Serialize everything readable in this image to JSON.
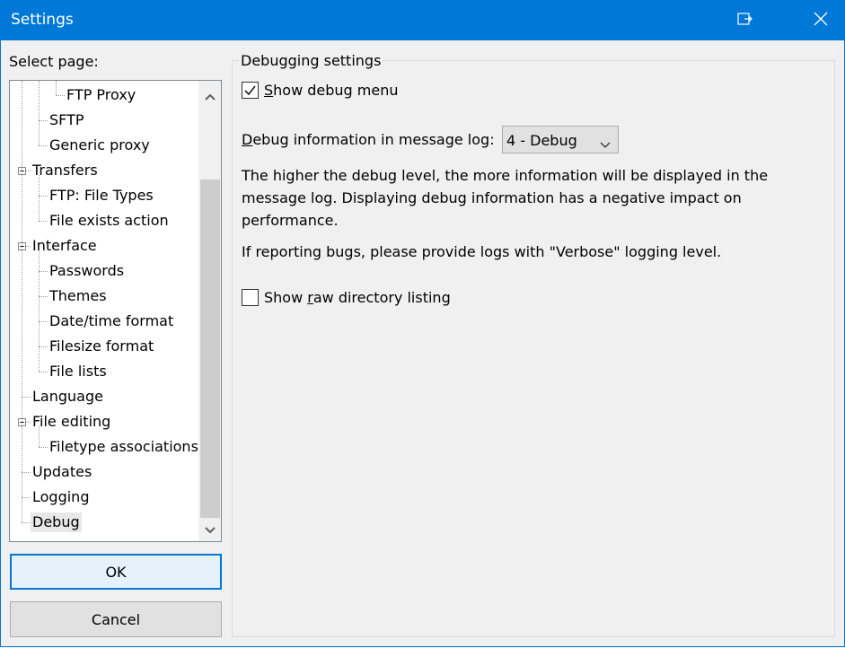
{
  "window": {
    "title": "Settings"
  },
  "left_panel": {
    "label": "Select page:",
    "tree_items": [
      {
        "label": "FTP Proxy",
        "level": 2
      },
      {
        "label": "SFTP",
        "level": 1
      },
      {
        "label": "Generic proxy",
        "level": 1
      },
      {
        "label": "Transfers",
        "level": 0,
        "expanded": true
      },
      {
        "label": "FTP: File Types",
        "level": 1
      },
      {
        "label": "File exists action",
        "level": 1
      },
      {
        "label": "Interface",
        "level": 0,
        "expanded": true
      },
      {
        "label": "Passwords",
        "level": 1
      },
      {
        "label": "Themes",
        "level": 1
      },
      {
        "label": "Date/time format",
        "level": 1
      },
      {
        "label": "Filesize format",
        "level": 1
      },
      {
        "label": "File lists",
        "level": 1
      },
      {
        "label": "Language",
        "level": 0
      },
      {
        "label": "File editing",
        "level": 0,
        "expanded": true
      },
      {
        "label": "Filetype associations",
        "level": 1
      },
      {
        "label": "Updates",
        "level": 0
      },
      {
        "label": "Logging",
        "level": 0
      },
      {
        "label": "Debug",
        "level": 0,
        "selected": true
      }
    ]
  },
  "buttons": {
    "ok": "OK",
    "cancel": "Cancel"
  },
  "debug_page": {
    "group_title": "Debugging settings",
    "show_debug_menu": {
      "label_pre": "",
      "label_key": "S",
      "label_post": "how debug menu",
      "checked": true
    },
    "debug_info_label": {
      "key": "D",
      "rest": "ebug information in message log:"
    },
    "debug_level": "4 - Debug",
    "description": "The higher the debug level, the more information will be displayed in the message log. Displaying debug information has a negative impact on performance.",
    "bug_report_note": "If reporting bugs, please provide logs with \"Verbose\" logging level.",
    "raw_listing": {
      "label_pre": "Show ",
      "label_key": "r",
      "label_post": "aw directory listing",
      "checked": false
    }
  },
  "colors": {
    "titlebar": "#0078d7",
    "window_bg": "#f0f0f0",
    "focus_border": "#0078d7"
  }
}
